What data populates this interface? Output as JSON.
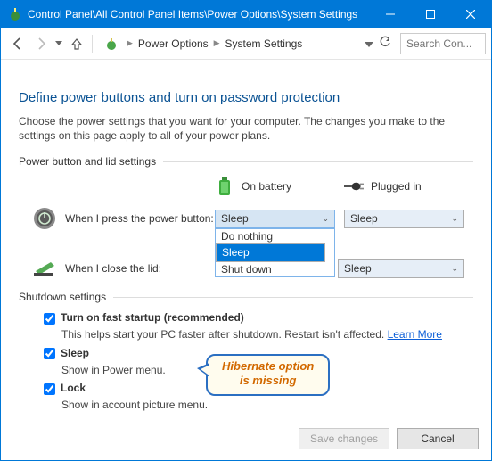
{
  "window": {
    "title": "Control Panel\\All Control Panel Items\\Power Options\\System Settings"
  },
  "breadcrumb": {
    "items": [
      "Power Options",
      "System Settings"
    ]
  },
  "search": {
    "placeholder": "Search Con..."
  },
  "heading": "Define power buttons and turn on password protection",
  "intro": "Choose the power settings that you want for your computer. The changes you make to the settings on this page apply to all of your power plans.",
  "group_power": "Power button and lid settings",
  "columns": {
    "battery": "On battery",
    "plugged": "Plugged in"
  },
  "rows": {
    "power_button": {
      "label": "When I press the power button:",
      "battery_value": "Sleep",
      "plugged_value": "Sleep",
      "dropdown_open": true,
      "options": [
        "Do nothing",
        "Sleep",
        "Shut down"
      ],
      "selected_index": 1
    },
    "lid": {
      "label": "When I close the lid:",
      "plugged_value": "Sleep"
    }
  },
  "group_shutdown": "Shutdown settings",
  "shutdown": {
    "fast": {
      "label": "Turn on fast startup (recommended)",
      "sub": "This helps start your PC faster after shutdown. Restart isn't affected.",
      "link": "Learn More"
    },
    "sleep": {
      "label": "Sleep",
      "sub": "Show in Power menu."
    },
    "lock": {
      "label": "Lock",
      "sub": "Show in account picture menu."
    }
  },
  "callout": {
    "line1": "Hibernate option",
    "line2": "is missing"
  },
  "buttons": {
    "save": "Save changes",
    "cancel": "Cancel"
  }
}
